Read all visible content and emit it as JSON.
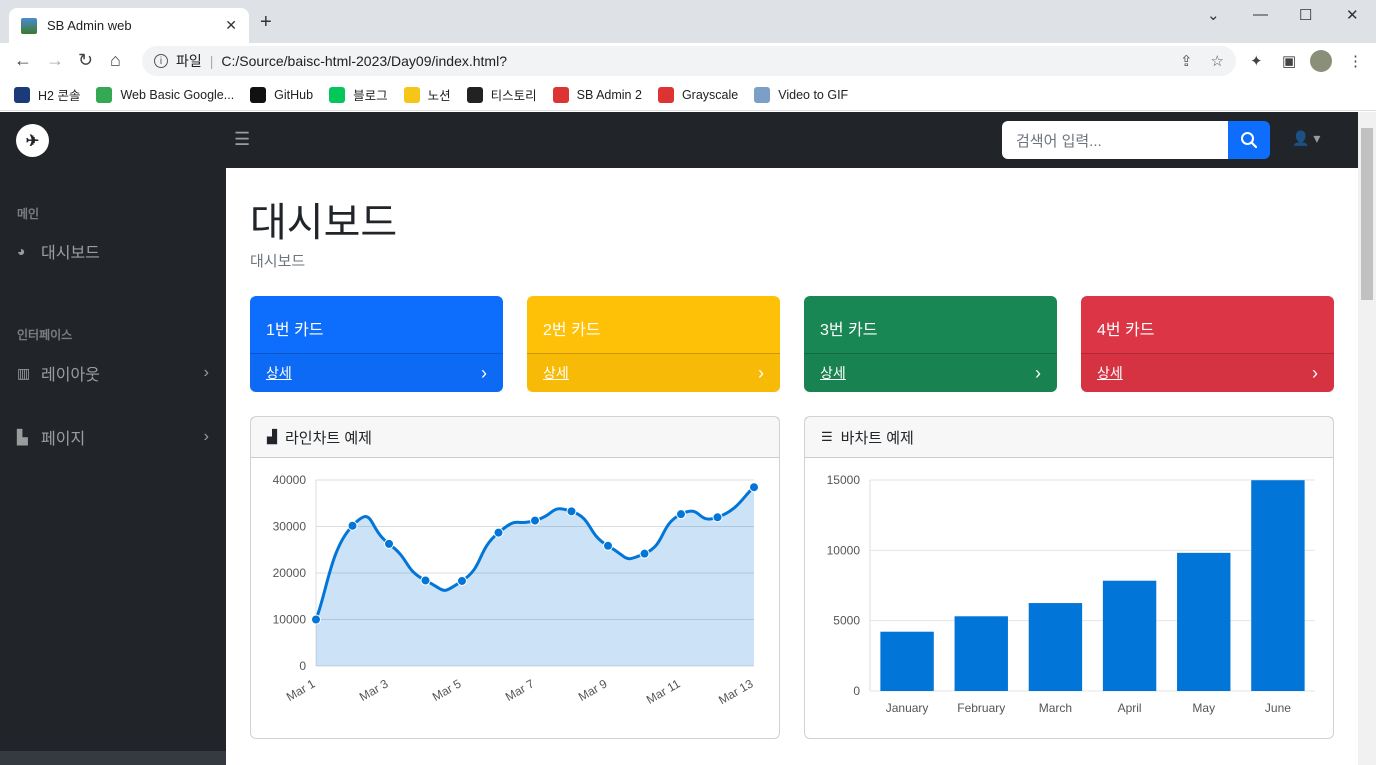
{
  "browser": {
    "tab_title": "SB Admin web",
    "new_tab": "+",
    "address_prefix": "파일",
    "address": "C:/Source/baisc-html-2023/Day09/index.html?",
    "bookmarks": [
      {
        "label": "H2 콘솔",
        "icon": "h2-icon",
        "color": "#1a3a7a"
      },
      {
        "label": "Web Basic Google...",
        "icon": "google-drive-icon",
        "color": "#34a853"
      },
      {
        "label": "GitHub",
        "icon": "github-icon",
        "color": "#111111"
      },
      {
        "label": "블로그",
        "icon": "blog-icon",
        "color": "#03c75a"
      },
      {
        "label": "노션",
        "icon": "heart-icon",
        "color": "#f5c518"
      },
      {
        "label": "티스토리",
        "icon": "tistory-icon",
        "color": "#222222"
      },
      {
        "label": "SB Admin 2",
        "icon": "sb-icon",
        "color": "#dd3333"
      },
      {
        "label": "Grayscale",
        "icon": "sb-icon",
        "color": "#dd3333"
      },
      {
        "label": "Video to GIF",
        "icon": "gif-icon",
        "color": "#7aa0c8"
      }
    ]
  },
  "navbar": {
    "search_placeholder": "검색어 입력..."
  },
  "sidebar": {
    "sections": [
      {
        "heading": "메인",
        "items": [
          {
            "label": "대시보드",
            "icon": "tachometer-icon",
            "chevron": false
          }
        ]
      },
      {
        "heading": "인터페이스",
        "items": [
          {
            "label": "레이아웃",
            "icon": "columns-icon",
            "chevron": true
          },
          {
            "label": "페이지",
            "icon": "book-open-icon",
            "chevron": true
          }
        ]
      }
    ]
  },
  "main": {
    "title": "대시보드",
    "breadcrumb": "대시보드",
    "cards": [
      {
        "title": "1번 카드",
        "link": "상세",
        "color": "#0d6efd"
      },
      {
        "title": "2번 카드",
        "link": "상세",
        "color": "#ffc107"
      },
      {
        "title": "3번 카드",
        "link": "상세",
        "color": "#198754"
      },
      {
        "title": "4번 카드",
        "link": "상세",
        "color": "#dc3545"
      }
    ],
    "line_panel_title": "라인차트 예제",
    "bar_panel_title": "바차트 예제"
  },
  "chart_data": [
    {
      "type": "area",
      "x": [
        "Mar 1",
        "Mar 2",
        "Mar 3",
        "Mar 4",
        "Mar 5",
        "Mar 6",
        "Mar 7",
        "Mar 8",
        "Mar 9",
        "Mar 10",
        "Mar 11",
        "Mar 12",
        "Mar 13"
      ],
      "x_tick_labels": [
        "Mar 1",
        "Mar 3",
        "Mar 5",
        "Mar 7",
        "Mar 9",
        "Mar 11",
        "Mar 13"
      ],
      "values": [
        10000,
        30162,
        26263,
        18394,
        18287,
        28682,
        31274,
        33259,
        25849,
        24159,
        32651,
        31984,
        38451
      ],
      "ylim": [
        0,
        40000
      ],
      "yticks": [
        0,
        10000,
        20000,
        30000,
        40000
      ],
      "color": "#0275d8",
      "fill": "rgba(2,117,216,0.2)",
      "grid": true
    },
    {
      "type": "bar",
      "categories": [
        "January",
        "February",
        "March",
        "April",
        "May",
        "June"
      ],
      "values": [
        4215,
        5312,
        6251,
        7841,
        9821,
        14984
      ],
      "ylim": [
        0,
        15000
      ],
      "yticks": [
        0,
        5000,
        10000,
        15000
      ],
      "color": "#0275d8",
      "grid": true
    }
  ]
}
